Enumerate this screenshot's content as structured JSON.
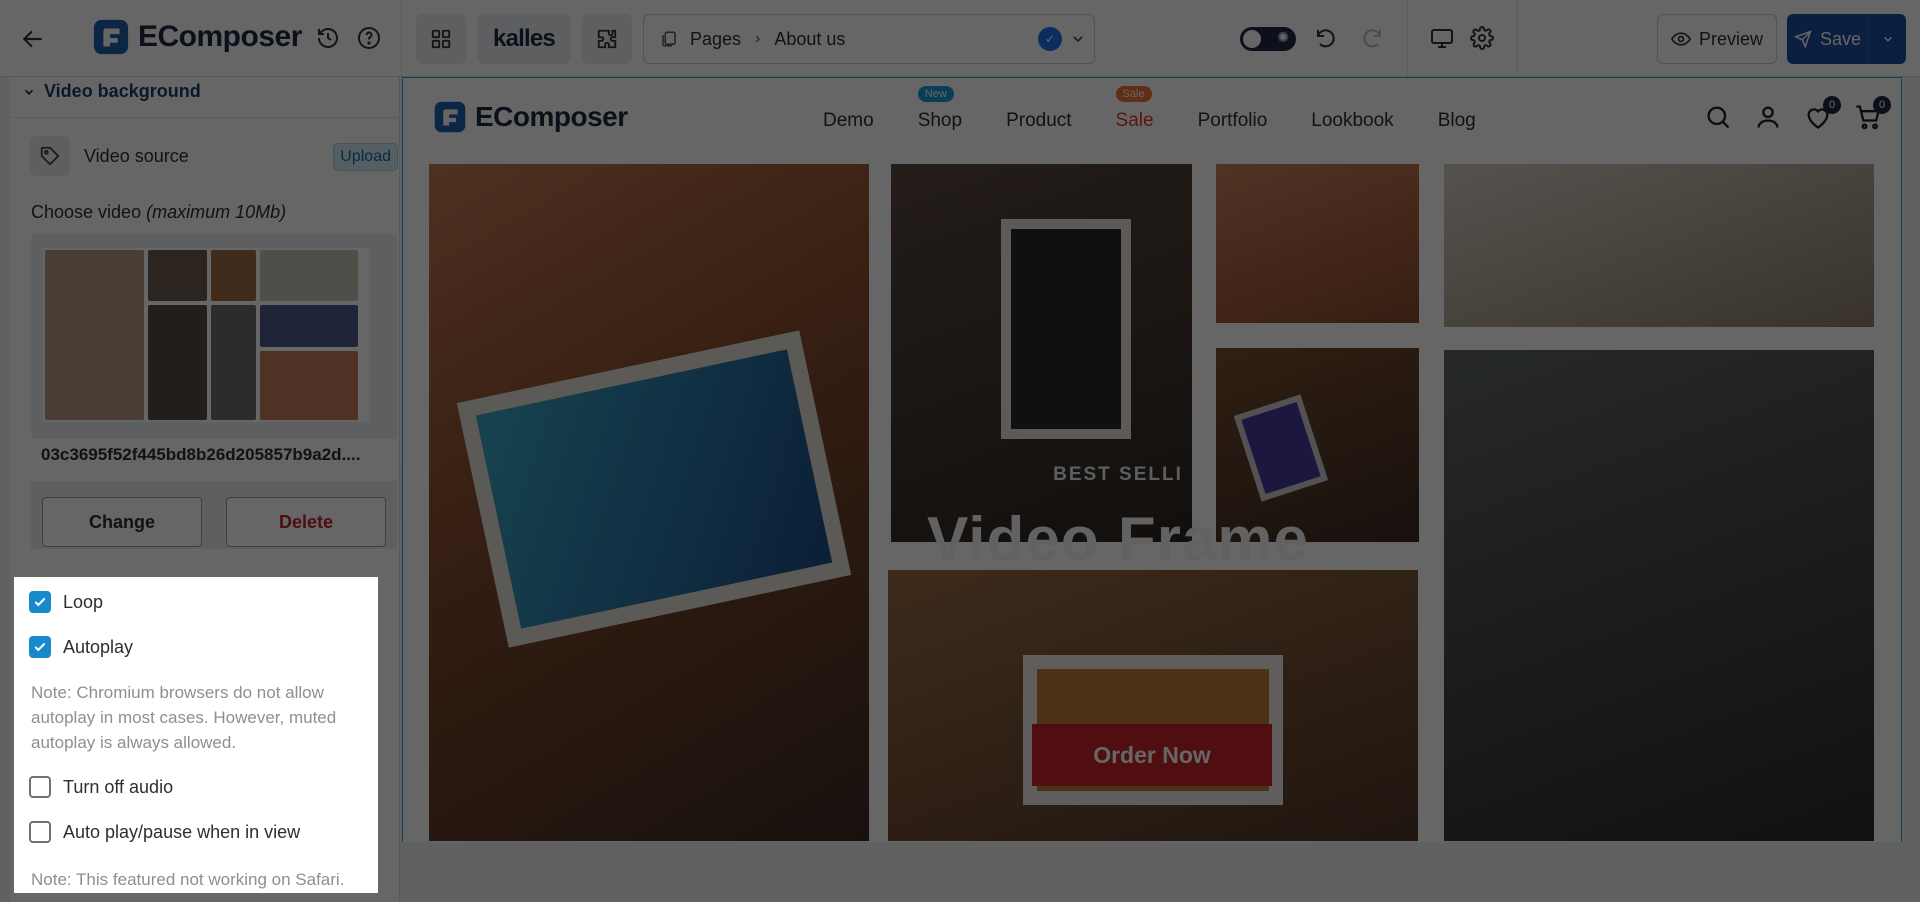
{
  "topbar": {
    "app_name": "EComposer",
    "theme_name": "kalles",
    "breadcrumb_root": "Pages",
    "breadcrumb_page": "About us",
    "preview_label": "Preview",
    "save_label": "Save"
  },
  "panel": {
    "section_title": "Video background",
    "video_source_label": "Video source",
    "upload_label": "Upload",
    "choose_label": "Choose video",
    "choose_hint": "(maximum 10Mb)",
    "filename": "03c3695f52f445bd8b26d205857b9a2d....",
    "change_label": "Change",
    "delete_label": "Delete",
    "options": {
      "loop": {
        "label": "Loop",
        "checked": true
      },
      "autoplay": {
        "label": "Autoplay",
        "checked": true
      },
      "autoplay_note": "Note: Chromium browsers do not allow autoplay in most cases. However, muted autoplay is always allowed.",
      "turn_off_audio": {
        "label": "Turn off audio",
        "checked": false
      },
      "auto_play_in_view": {
        "label": "Auto play/pause when in view",
        "checked": false
      },
      "safari_note": "Note: This featured not working on Safari."
    }
  },
  "store": {
    "logo_text": "EComposer",
    "nav": [
      {
        "label": "Demo"
      },
      {
        "label": "Shop",
        "badge": "New"
      },
      {
        "label": "Product"
      },
      {
        "label": "Sale",
        "badge": "Sale"
      },
      {
        "label": "Portfolio"
      },
      {
        "label": "Lookbook"
      },
      {
        "label": "Blog"
      }
    ],
    "wishlist_count": "0",
    "cart_count": "0",
    "hero": {
      "eyebrow": "BEST SELLI",
      "title": "Video Frame",
      "cta": "Order Now"
    }
  },
  "colors": {
    "brand": "#1f2a44",
    "accent": "#168acb",
    "save": "#1d4fa3",
    "cta": "#c8232b",
    "sale": "#e0342b"
  }
}
